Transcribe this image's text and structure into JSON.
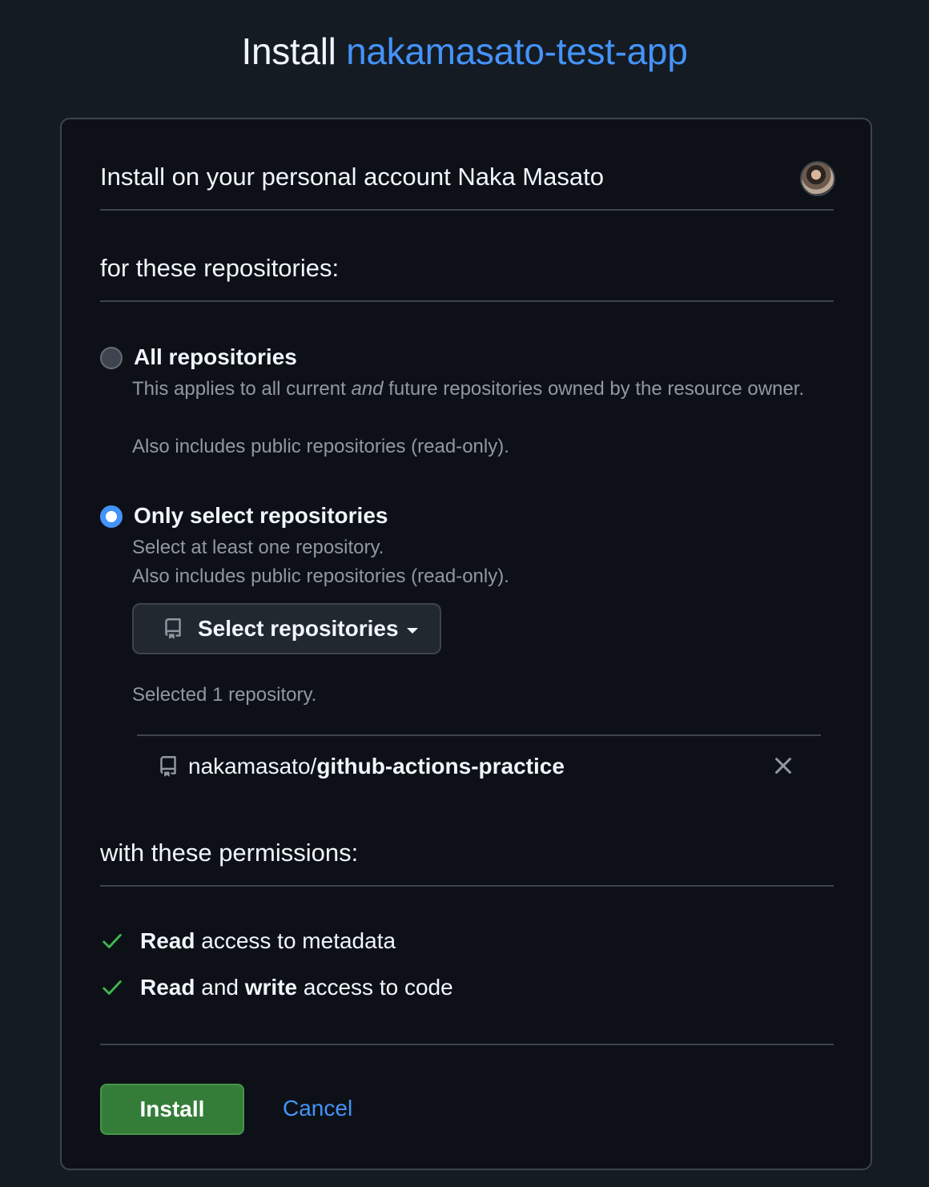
{
  "header": {
    "prefix": "Install",
    "app_name": "nakamasato-test-app"
  },
  "account": {
    "title": "Install on your personal account Naka Masato"
  },
  "repositories": {
    "section_title": "for these repositories:",
    "all": {
      "title": "All repositories",
      "desc_part1": "This applies to all current ",
      "desc_em": "and",
      "desc_part2": " future repositories owned by the resource owner.",
      "desc_line2": "Also includes public repositories (read-only).",
      "selected": false
    },
    "only_select": {
      "title": "Only select repositories",
      "desc_line1": "Select at least one repository.",
      "desc_line2": "Also includes public repositories (read-only).",
      "selected": true
    },
    "select_button_label": "Select repositories",
    "selected_count_text": "Selected 1 repository.",
    "selected_list": [
      {
        "owner": "nakamasato/",
        "name": "github-actions-practice"
      }
    ]
  },
  "permissions": {
    "section_title": "with these permissions:",
    "items": [
      {
        "bold1": "Read",
        "text1": " access to metadata",
        "bold2": "",
        "text2": ""
      },
      {
        "bold1": "Read",
        "text1": " and ",
        "bold2": "write",
        "text2": " access to code"
      }
    ]
  },
  "actions": {
    "install_label": "Install",
    "cancel_label": "Cancel"
  },
  "colors": {
    "accent": "#4493f8",
    "success": "#347d39",
    "check": "#3fb950"
  }
}
